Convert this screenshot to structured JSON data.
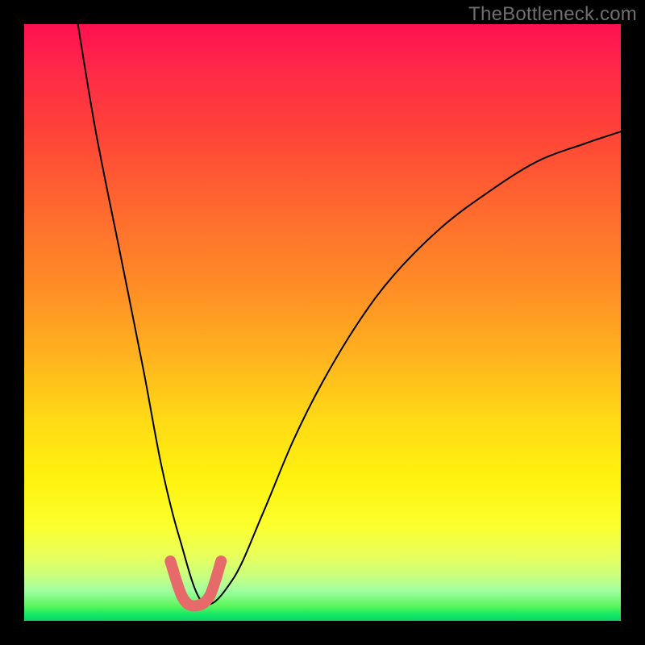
{
  "watermark": "TheBottleneck.com",
  "chart_data": {
    "type": "line",
    "title": "",
    "xlabel": "",
    "ylabel": "",
    "xlim": [
      0,
      100
    ],
    "ylim": [
      0,
      100
    ],
    "grid": false,
    "legend": false,
    "series": [
      {
        "name": "curve",
        "stroke": "#000000",
        "stroke_width": 2,
        "x": [
          9,
          12,
          16,
          20,
          23,
          26,
          30,
          35,
          40,
          45,
          50,
          56,
          62,
          70,
          78,
          86,
          94,
          100
        ],
        "values": [
          100,
          82,
          62,
          42,
          26,
          14,
          3,
          7,
          18,
          30,
          40,
          50,
          58,
          66,
          72,
          77,
          80,
          82
        ]
      },
      {
        "name": "optimum-marker",
        "stroke": "#e66a6a",
        "stroke_width": 14,
        "x": [
          24.5,
          26.5,
          28.5,
          31.0,
          33.0
        ],
        "values": [
          10,
          4,
          2.5,
          4,
          10
        ]
      }
    ],
    "background_gradient": {
      "top": "#ff1050",
      "mid": "#fff20e",
      "bottom": "#0cd368"
    }
  }
}
